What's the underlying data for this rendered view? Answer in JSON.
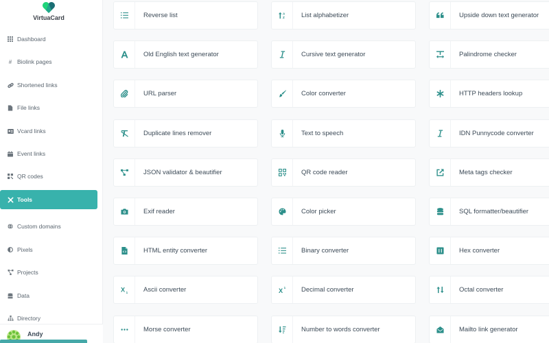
{
  "brand": {
    "name": "VirtuaCard",
    "accent_color": "#38b2ac",
    "icon_color": "#2c8f8a"
  },
  "sidebar": {
    "items": [
      {
        "label": "Dashboard",
        "icon": "grid-icon",
        "active": false
      },
      {
        "label": "Biolink pages",
        "icon": "hashtag-icon",
        "active": false
      },
      {
        "label": "Shortened links",
        "icon": "link-icon",
        "active": false
      },
      {
        "label": "File links",
        "icon": "file-icon",
        "active": false
      },
      {
        "label": "Vcard links",
        "icon": "id-card-icon",
        "active": false
      },
      {
        "label": "Event links",
        "icon": "calendar-icon",
        "active": false
      },
      {
        "label": "QR codes",
        "icon": "qrcode-icon",
        "active": false
      },
      {
        "label": "Tools",
        "icon": "tools-icon",
        "active": true
      },
      {
        "label": "Custom domains",
        "icon": "globe-icon",
        "active": false
      },
      {
        "label": "Pixels",
        "icon": "adjust-icon",
        "active": false
      },
      {
        "label": "Projects",
        "icon": "project-diagram-icon",
        "active": false
      },
      {
        "label": "Data",
        "icon": "database-icon",
        "active": false
      },
      {
        "label": "Directory",
        "icon": "sitemap-icon",
        "active": false
      }
    ],
    "user": {
      "name": "Andy"
    }
  },
  "tools": [
    {
      "label": "Reverse list",
      "icon": "list-ol-icon"
    },
    {
      "label": "List alphabetizer",
      "icon": "sort-alpha-icon"
    },
    {
      "label": "Upside down text generator",
      "icon": "quote-left-icon"
    },
    {
      "label": "Old English text generator",
      "icon": "font-icon"
    },
    {
      "label": "Cursive text generator",
      "icon": "italic-icon"
    },
    {
      "label": "Palindrome checker",
      "icon": "text-width-icon"
    },
    {
      "label": "URL parser",
      "icon": "paperclip-icon"
    },
    {
      "label": "Color converter",
      "icon": "paint-brush-icon"
    },
    {
      "label": "HTTP headers lookup",
      "icon": "asterisk-icon"
    },
    {
      "label": "Duplicate lines remover",
      "icon": "remove-format-icon"
    },
    {
      "label": "Text to speech",
      "icon": "microphone-icon"
    },
    {
      "label": "IDN Punnycode converter",
      "icon": "italic-icon"
    },
    {
      "label": "JSON validator & beautifier",
      "icon": "project-diagram-icon"
    },
    {
      "label": "QR code reader",
      "icon": "qrcode-icon"
    },
    {
      "label": "Meta tags checker",
      "icon": "external-link-icon"
    },
    {
      "label": "Exif reader",
      "icon": "camera-icon"
    },
    {
      "label": "Color picker",
      "icon": "palette-icon"
    },
    {
      "label": "SQL formatter/beautifier",
      "icon": "database-icon"
    },
    {
      "label": "HTML entity converter",
      "icon": "file-code-icon"
    },
    {
      "label": "Binary converter",
      "icon": "list-ol-icon"
    },
    {
      "label": "Hex converter",
      "icon": "hex-box-icon"
    },
    {
      "label": "Ascii converter",
      "icon": "subscript-icon"
    },
    {
      "label": "Decimal converter",
      "icon": "superscript-icon"
    },
    {
      "label": "Octal converter",
      "icon": "sort-arrows-icon"
    },
    {
      "label": "Morse converter",
      "icon": "ellipsis-icon"
    },
    {
      "label": "Number to words converter",
      "icon": "sort-numeric-icon"
    },
    {
      "label": "Mailto link generator",
      "icon": "envelope-open-icon"
    }
  ]
}
